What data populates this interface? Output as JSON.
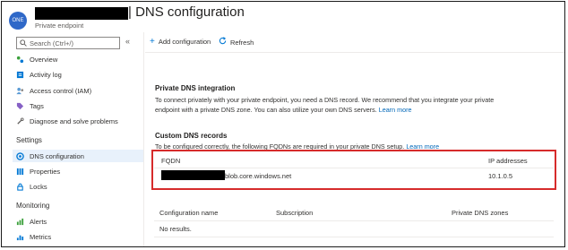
{
  "header": {
    "avatar_text": "ONE",
    "title": "| DNS configuration",
    "subtitle": "Private endpoint",
    "more_label": "···"
  },
  "sidebar": {
    "search_placeholder": "Search (Ctrl+/)",
    "collapse_label": "«",
    "items_top": [
      {
        "label": "Overview",
        "icon": "overview-icon"
      },
      {
        "label": "Activity log",
        "icon": "activity-log-icon"
      },
      {
        "label": "Access control (IAM)",
        "icon": "iam-icon"
      },
      {
        "label": "Tags",
        "icon": "tag-icon"
      },
      {
        "label": "Diagnose and solve problems",
        "icon": "wrench-icon"
      }
    ],
    "section_settings": "Settings",
    "items_settings": [
      {
        "label": "DNS configuration",
        "icon": "dns-icon",
        "active": true
      },
      {
        "label": "Properties",
        "icon": "properties-icon"
      },
      {
        "label": "Locks",
        "icon": "lock-icon"
      }
    ],
    "section_monitoring": "Monitoring",
    "items_monitoring": [
      {
        "label": "Alerts",
        "icon": "alerts-icon"
      },
      {
        "label": "Metrics",
        "icon": "metrics-icon"
      }
    ]
  },
  "toolbar": {
    "add_label": "Add configuration",
    "refresh_label": "Refresh"
  },
  "private_dns": {
    "heading": "Private DNS integration",
    "text": "To connect privately with your private endpoint, you need a DNS record. We recommend that you integrate your private endpoint with a private DNS zone. You can also utilize your own DNS servers.",
    "link": "Learn more"
  },
  "custom_dns": {
    "heading": "Custom DNS records",
    "text": "To be configured correctly, the following FQDNs are required in your private DNS setup.",
    "link": "Learn more",
    "columns": [
      "FQDN",
      "IP addresses"
    ],
    "rows": [
      {
        "fqdn_suffix": "blob.core.windows.net",
        "ip": "10.1.0.5"
      }
    ]
  },
  "config_table": {
    "columns": [
      "Configuration name",
      "Subscription",
      "Private DNS zones"
    ],
    "empty_text": "No results."
  },
  "colors": {
    "accent": "#0078d4",
    "highlight_border": "#d62b2b",
    "active_item_bg": "#e8f1fb"
  }
}
